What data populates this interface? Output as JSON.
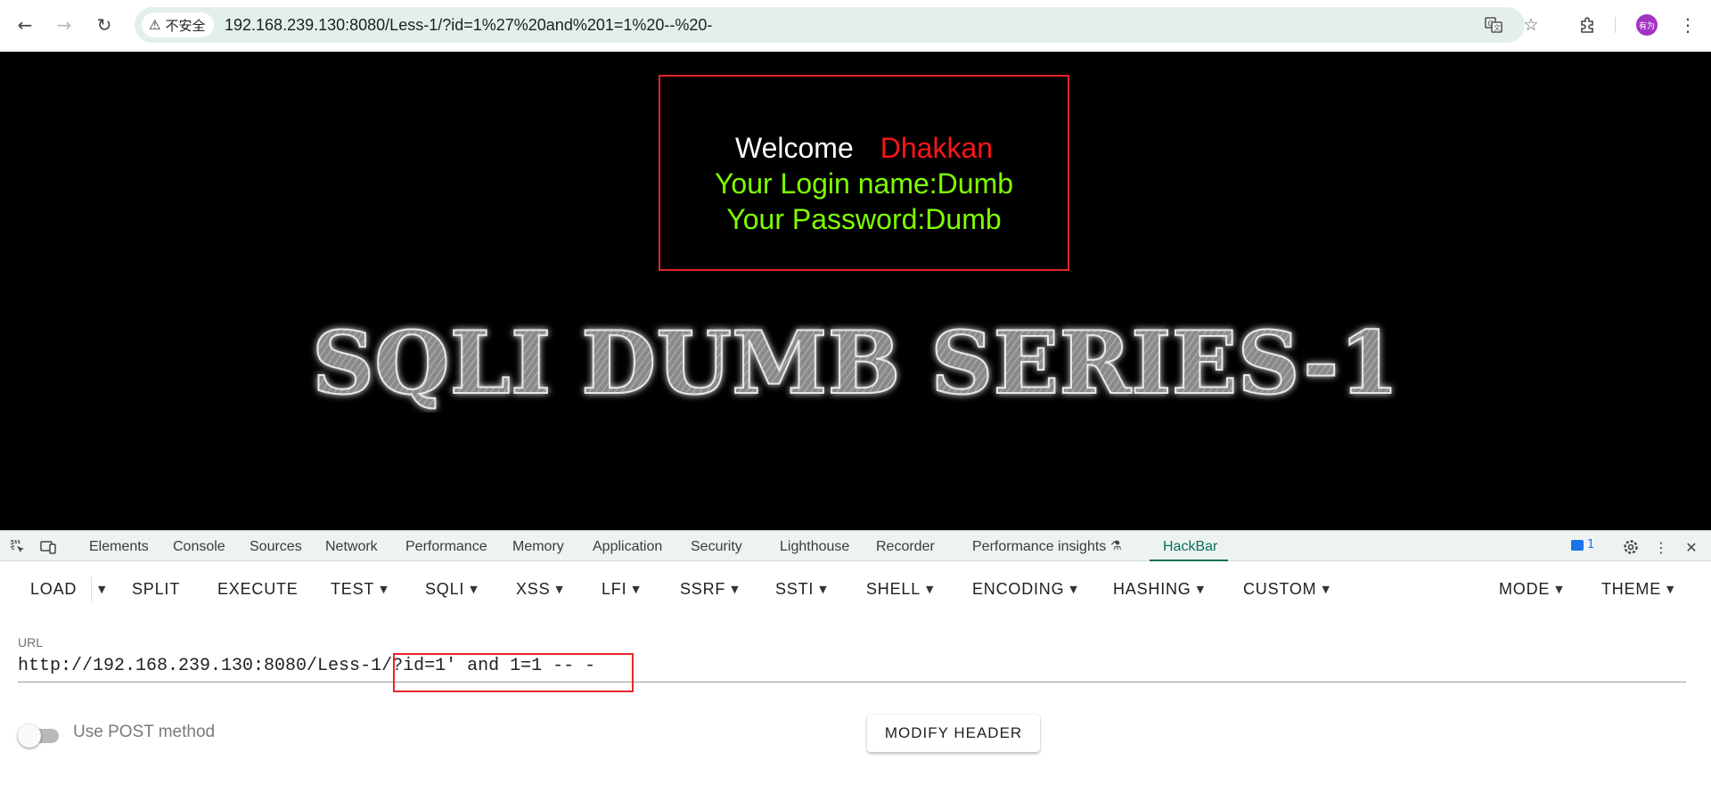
{
  "browser": {
    "back_icon": "←",
    "forward_icon": "→",
    "reload_icon": "↻",
    "security_label": "不安全",
    "security_icon": "⚠",
    "address": "192.168.239.130:8080/Less-1/?id=1%27%20and%201=1%20--%20-",
    "translate_icon": "translate",
    "bookmark_icon": "☆",
    "extensions_icon": "puzzle",
    "profile_label": "有为",
    "menu_icon": "⋮"
  },
  "page": {
    "welcome_label": "Welcome",
    "welcome_user": "Dhakkan",
    "login_line": "Your Login name:Dumb",
    "password_line": "Your Password:Dumb",
    "banner_title": "SQLI DUMB SERIES-1"
  },
  "devtools": {
    "tabs": [
      {
        "label": "Elements"
      },
      {
        "label": "Console"
      },
      {
        "label": "Sources"
      },
      {
        "label": "Network"
      },
      {
        "label": "Performance"
      },
      {
        "label": "Memory"
      },
      {
        "label": "Application"
      },
      {
        "label": "Security"
      },
      {
        "label": "Lighthouse"
      },
      {
        "label": "Recorder"
      },
      {
        "label": "Performance insights"
      },
      {
        "label": "HackBar"
      }
    ],
    "active_tab": "HackBar",
    "issues_count": "1"
  },
  "hackbar": {
    "buttons": [
      {
        "label": "LOAD"
      },
      {
        "label": "SPLIT"
      },
      {
        "label": "EXECUTE"
      },
      {
        "label": "TEST"
      },
      {
        "label": "SQLI"
      },
      {
        "label": "XSS"
      },
      {
        "label": "LFI"
      },
      {
        "label": "SSRF"
      },
      {
        "label": "SSTI"
      },
      {
        "label": "SHELL"
      },
      {
        "label": "ENCODING"
      },
      {
        "label": "HASHING"
      },
      {
        "label": "CUSTOM"
      },
      {
        "label": "MODE"
      },
      {
        "label": "THEME"
      }
    ],
    "url_label": "URL",
    "url_value": "http://192.168.239.130:8080/Less-1/?id=1' and 1=1 -- -",
    "post_toggle_label": "Use POST method",
    "post_toggle_on": false,
    "modify_header_label": "MODIFY HEADER"
  }
}
